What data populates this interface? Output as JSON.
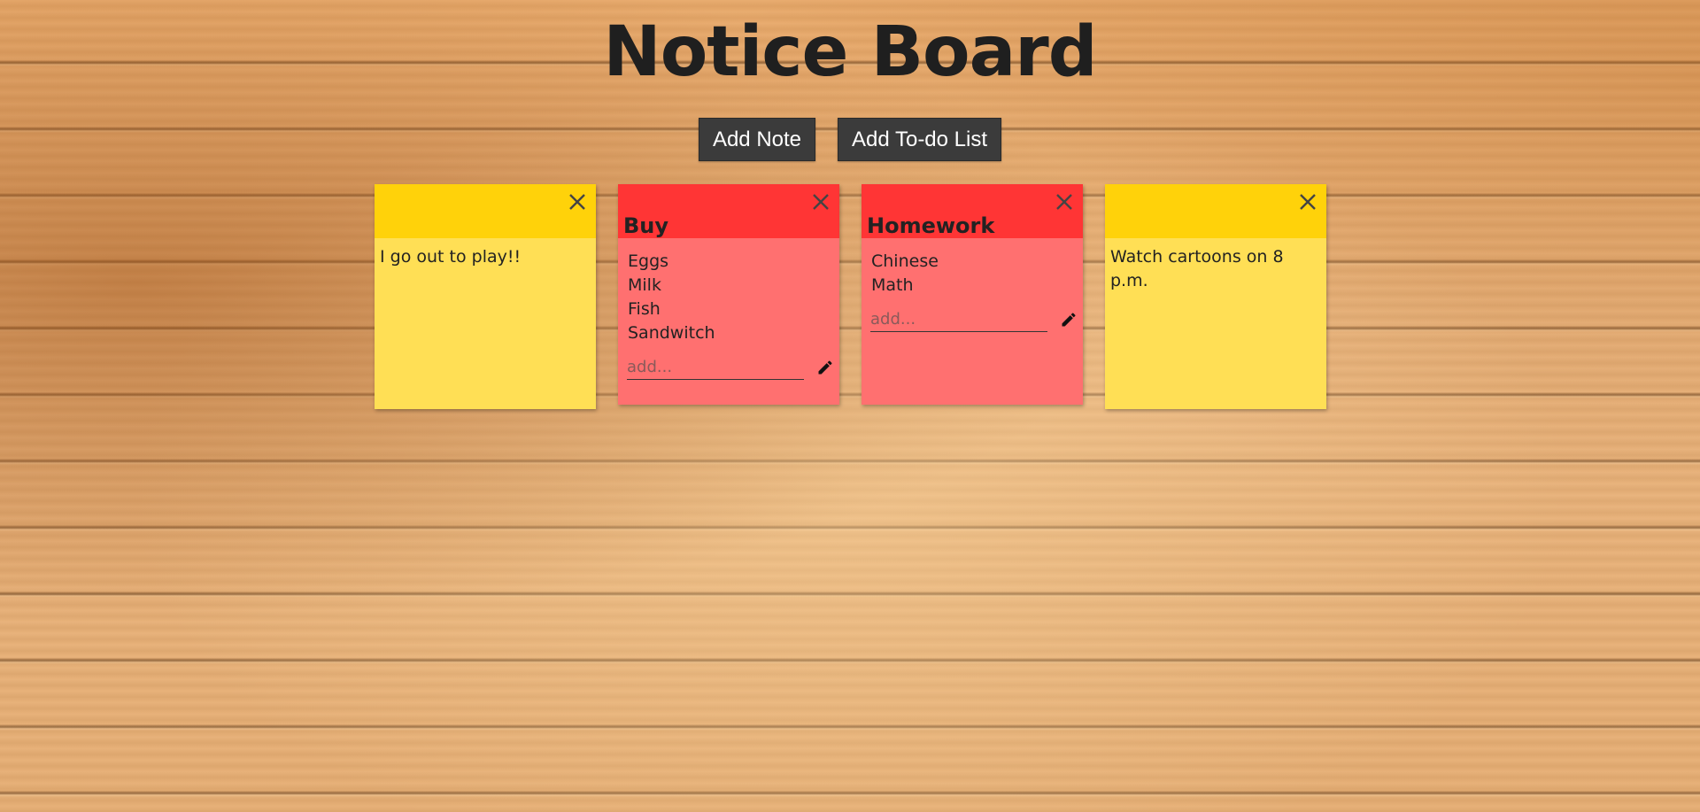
{
  "page": {
    "title": "Notice Board"
  },
  "toolbar": {
    "add_note_label": "Add Note",
    "add_todo_label": "Add To-do List"
  },
  "cards": [
    {
      "type": "note",
      "title": "",
      "text": "I go out to play!!"
    },
    {
      "type": "todo",
      "title": "Buy",
      "items": [
        "Eggs",
        "Milk",
        "Fish",
        "Sandwitch"
      ],
      "input_placeholder": "add..."
    },
    {
      "type": "todo",
      "title": "Homework",
      "items": [
        "Chinese",
        "Math"
      ],
      "input_placeholder": "add..."
    },
    {
      "type": "note",
      "title": "",
      "text": "Watch cartoons on 8 p.m."
    }
  ],
  "icons": {
    "close": "close-icon",
    "edit": "pencil-icon"
  },
  "colors": {
    "note_header": "#ffd20a",
    "note_body": "#ffdf55",
    "todo_header": "#ff3535",
    "todo_body": "#ff7070",
    "button_bg": "#3b3b3b"
  }
}
